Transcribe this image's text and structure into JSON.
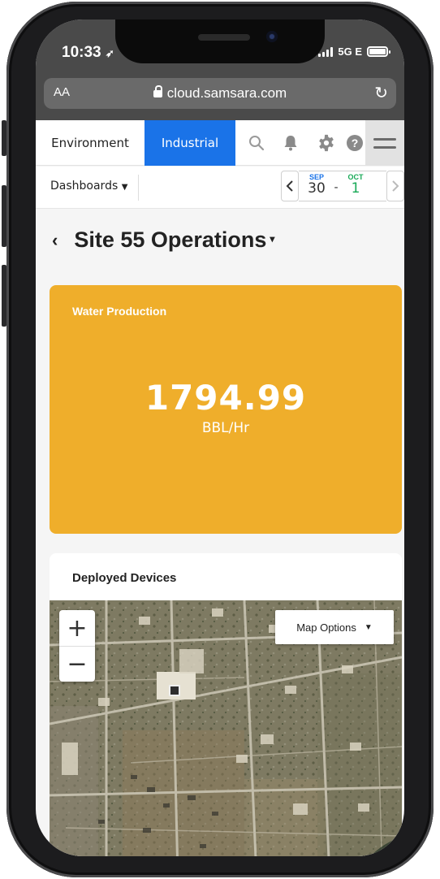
{
  "status_bar": {
    "time": "10:33",
    "carrier": "5G E"
  },
  "browser": {
    "aa_label": "AA",
    "url": "cloud.samsara.com"
  },
  "nav": {
    "tabs": [
      {
        "label": "Environment",
        "active": false
      },
      {
        "label": "Industrial",
        "active": true
      }
    ],
    "icons": [
      "search-icon",
      "bell-icon",
      "gear-icon",
      "help-icon",
      "menu-icon"
    ]
  },
  "dashbar": {
    "dashboards_label": "Dashboards",
    "date_range": {
      "start": {
        "month": "SEP",
        "day": "30"
      },
      "separator": "-",
      "end": {
        "month": "OCT",
        "day": "1"
      }
    }
  },
  "page": {
    "title": "Site 55 Operations"
  },
  "kpi": {
    "label": "Water Production",
    "value": "1794.99",
    "unit": "BBL/Hr",
    "color": "#efae2b"
  },
  "devices_card": {
    "title": "Deployed Devices",
    "zoom_in": "+",
    "zoom_out": "−",
    "map_options_label": "Map Options"
  },
  "colors": {
    "accent": "#1a73e8",
    "date_end": "#18a957"
  }
}
